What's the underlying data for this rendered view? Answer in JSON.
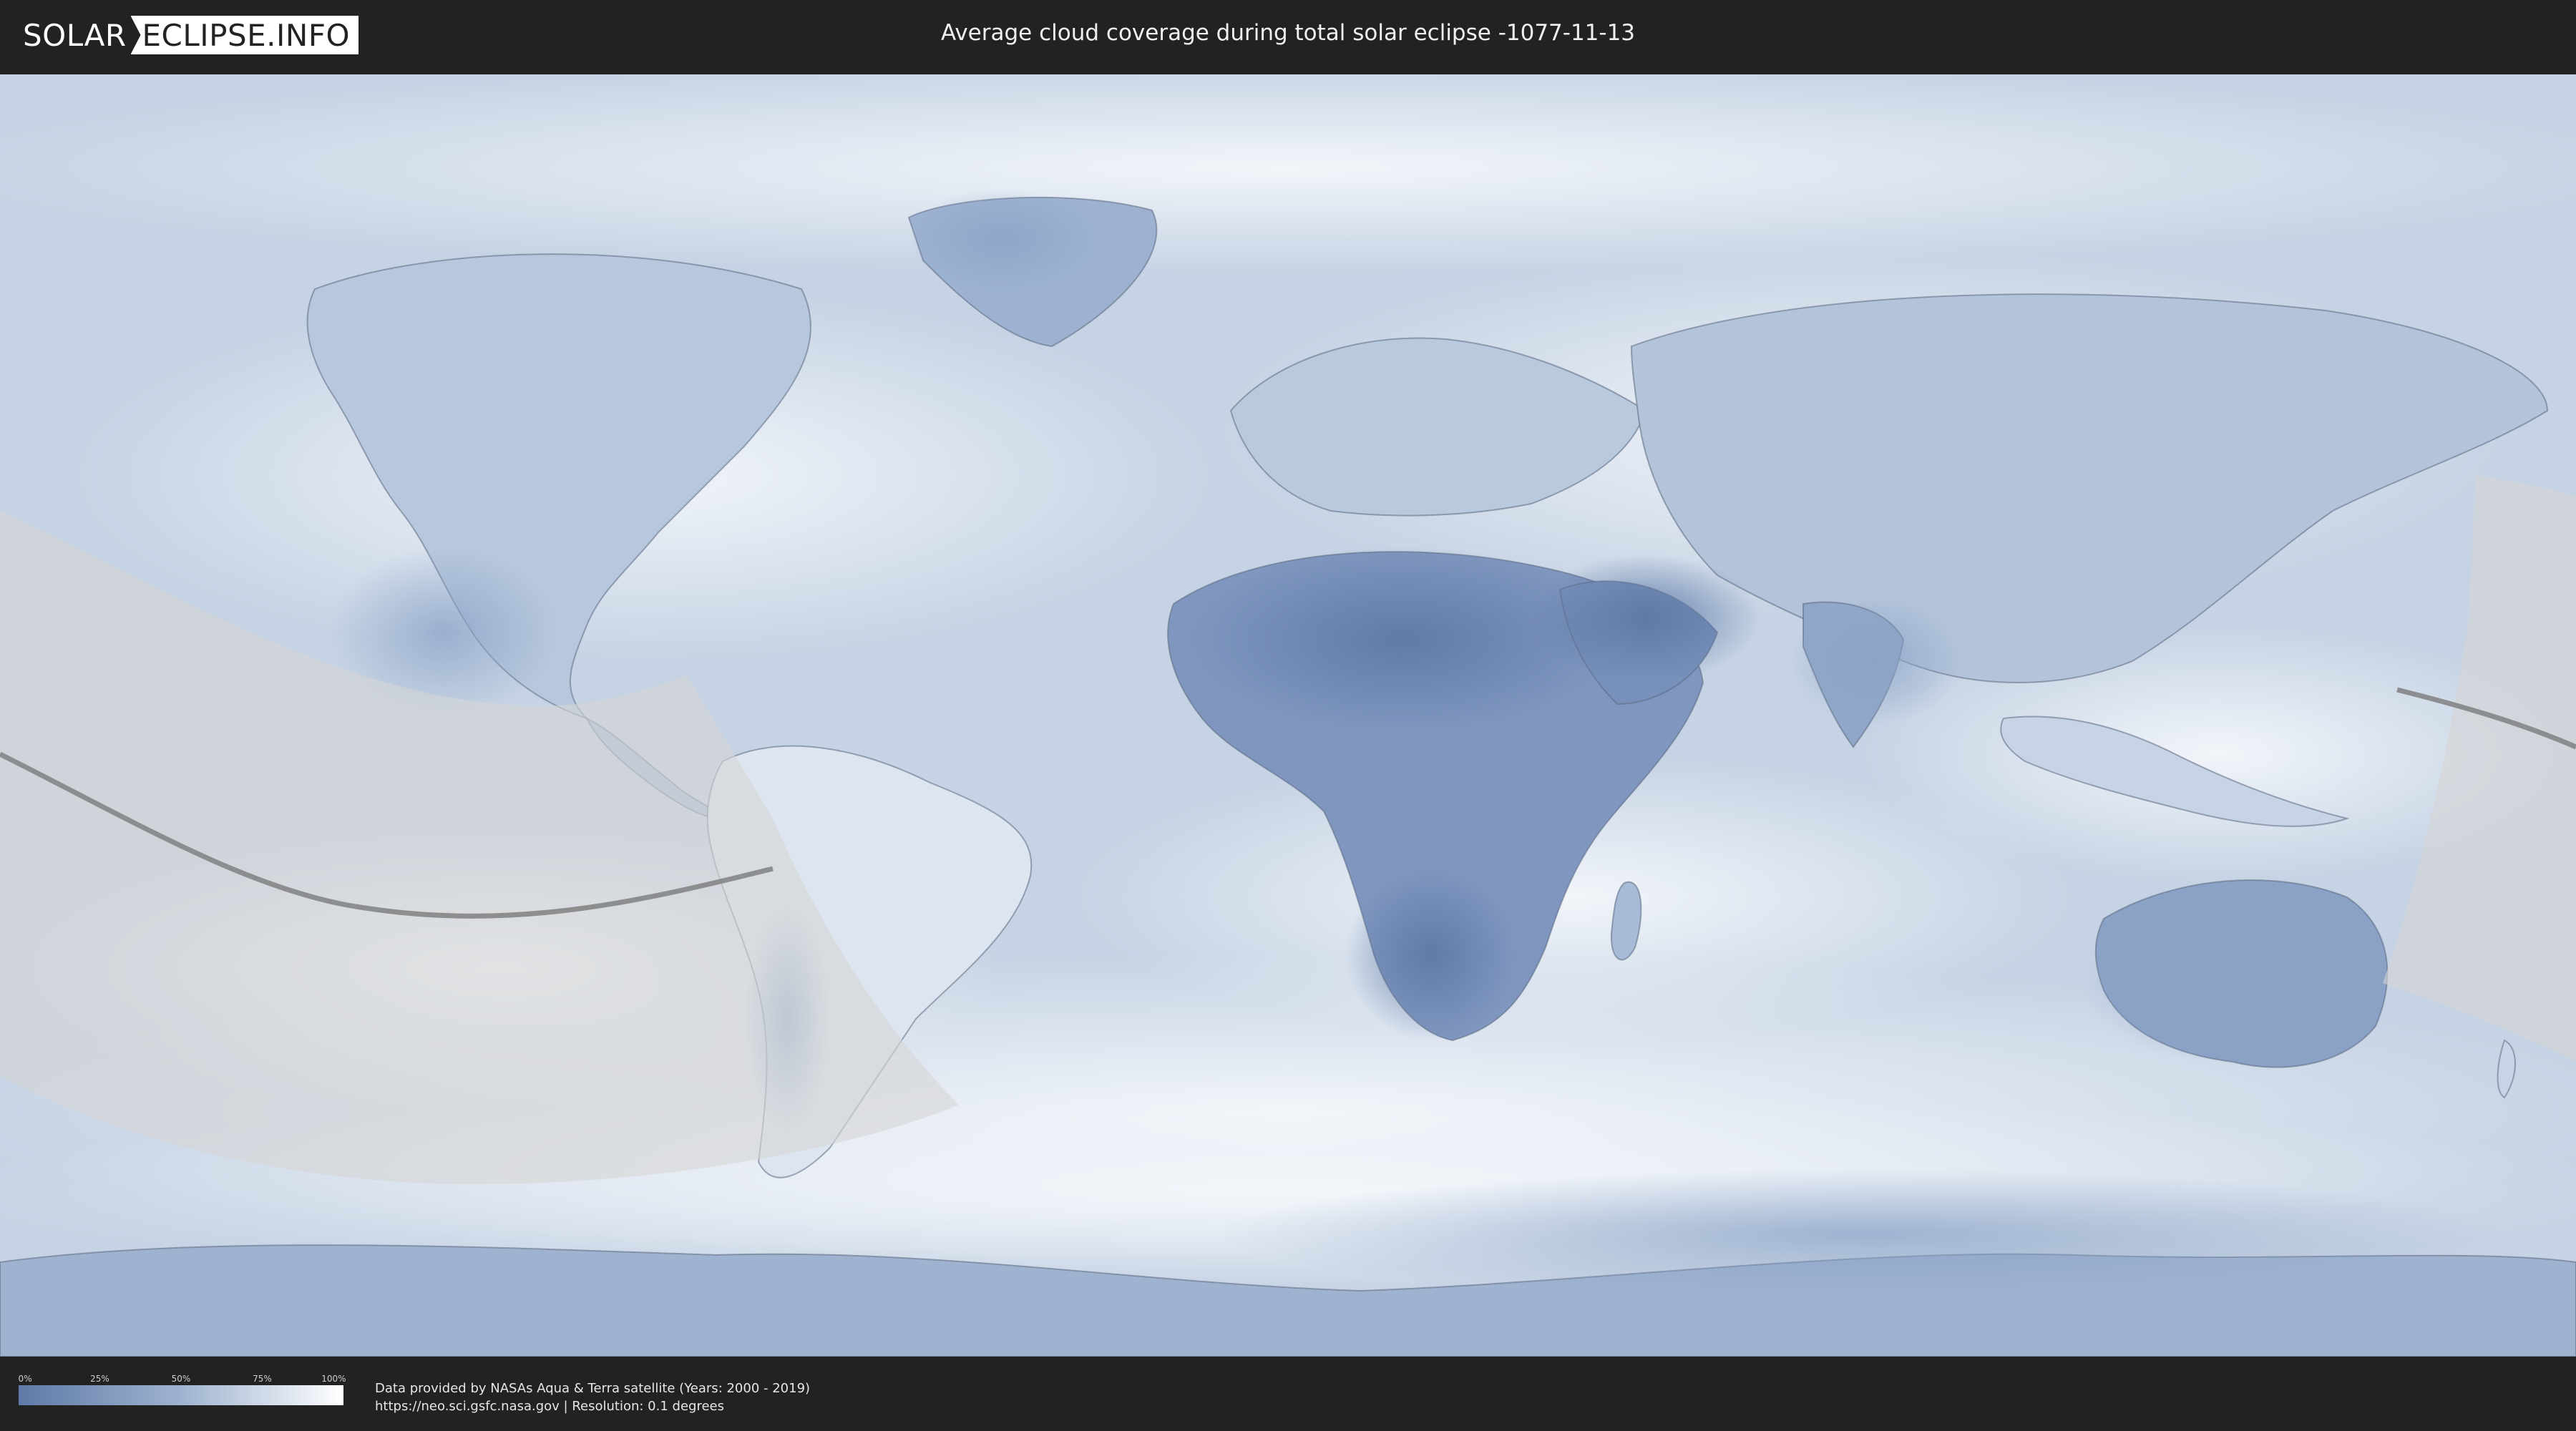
{
  "header": {
    "logo_left": "SOLAR",
    "logo_right": "ECLIPSE.INFO",
    "title": "Average cloud coverage during total solar eclipse -1077-11-13"
  },
  "map": {
    "colors": {
      "ocean_clear": "#b9c9de",
      "cloud": "#eef2f7",
      "land_dark": "#6f87b0",
      "land_mid": "#9fb3d0",
      "eclipse_band": "#d9d9d9",
      "central_line": "#7a7a7a",
      "coastline": "#5c6a80"
    }
  },
  "legend": {
    "ticks": [
      "0%",
      "25%",
      "50%",
      "75%",
      "100%"
    ],
    "gradient_colors": [
      "#5f7aa7",
      "#9fb3d0",
      "#ffffff"
    ]
  },
  "footer": {
    "credit_line1": "Data provided by NASAs Aqua & Terra satellite (Years: 2000 - 2019)",
    "credit_line2": "https://neo.sci.gsfc.nasa.gov | Resolution: 0.1 degrees"
  }
}
